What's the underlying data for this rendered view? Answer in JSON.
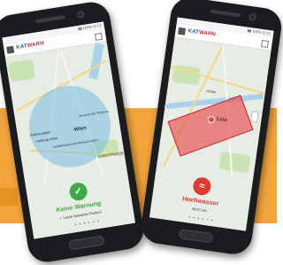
{
  "left_phone": {
    "app_logo": {
      "part1": "KAT",
      "part2": "WARN"
    },
    "map_labels": [
      "Wien",
      "Rathausplatz",
      "Hofburg Wien",
      "Museum der Moderne",
      "Kunsthistorisches Museum Wien",
      "LANDSTRASSE"
    ],
    "status": {
      "icon": "check-icon",
      "title": "Keine Warnung",
      "subtitle": "✓ Letzte bekannte Position",
      "color": "#3daa48"
    },
    "pager": "• • • • • •"
  },
  "right_phone": {
    "app_logo": {
      "part1": "KAT",
      "part2": "WARN"
    },
    "map_labels": [
      "Linz",
      "Urfahr"
    ],
    "status": {
      "icon": "flood-icon",
      "title": "Hochwasser",
      "subtitle": "4020 Linz",
      "color": "#e23a2f"
    },
    "pager": "• • • • • •"
  },
  "colors": {
    "background_band": "#f2a43a",
    "brand_blue": "#2c56a4",
    "brand_red": "#d8262f"
  }
}
